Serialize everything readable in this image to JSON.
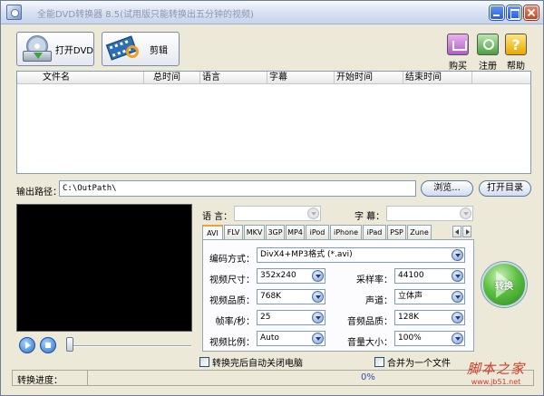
{
  "window": {
    "title": "全能DVD转换器 8.5(试用版只能转换出五分钟的视频)"
  },
  "toolbar": {
    "open_dvd_label": "打开DVD",
    "edit_label": "剪辑",
    "buy_label": "购买",
    "register_label": "注册",
    "help_label": "帮助"
  },
  "file_list": {
    "columns": [
      "文件名",
      "总时间",
      "语言",
      "字幕",
      "开始时间",
      "结束时间"
    ]
  },
  "output": {
    "label": "输出路径：",
    "path": "C:\\OutPath\\",
    "browse_label": "浏览...",
    "open_dir_label": "打开目录"
  },
  "audio_subtitle": {
    "language_label": "语  言：",
    "subtitle_label": "字  幕："
  },
  "format_tabs": [
    "AVI",
    "FLV",
    "MKV",
    "3GP",
    "MP4",
    "iPod",
    "iPhone",
    "iPad",
    "PSP",
    "Zune"
  ],
  "settings": {
    "codec_label": "编码方式：",
    "codec_value": "DivX4+MP3格式 (*.avi)",
    "video_size_label": "视频尺寸：",
    "video_size_value": "352x240",
    "sample_rate_label": "采样率：",
    "sample_rate_value": "44100",
    "video_quality_label": "视频品质：",
    "video_quality_value": "768K",
    "channel_label": "声道：",
    "channel_value": "立体声",
    "fps_label": "帧率/秒：",
    "fps_value": "25",
    "audio_quality_label": "音频品质：",
    "audio_quality_value": "128K",
    "aspect_label": "视频比例：",
    "aspect_value": "Auto",
    "volume_label": "音量大小：",
    "volume_value": "100%"
  },
  "convert_label": "转换",
  "options": {
    "shutdown_label": "转换完后自动关闭电脑",
    "merge_label": "合并为一个文件"
  },
  "status": {
    "progress_label": "转换进度：",
    "progress_text": "0%"
  },
  "watermark": {
    "text": "脚本之家",
    "url": "www.jb51.net"
  }
}
